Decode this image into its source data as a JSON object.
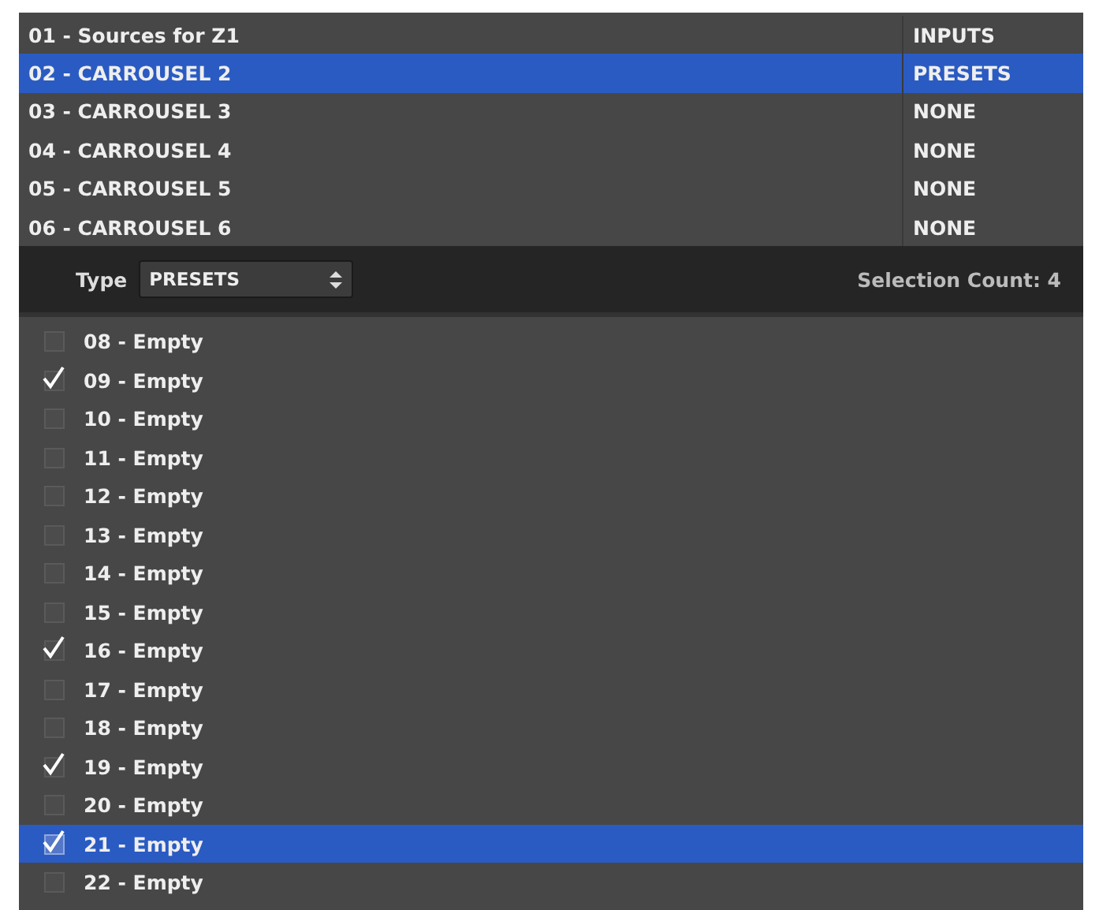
{
  "sources": [
    {
      "name": "01 - Sources for Z1",
      "type": "INPUTS",
      "selected": false
    },
    {
      "name": "02 - CARROUSEL 2",
      "type": "PRESETS",
      "selected": true
    },
    {
      "name": "03 - CARROUSEL 3",
      "type": "NONE",
      "selected": false
    },
    {
      "name": "04 - CARROUSEL 4",
      "type": "NONE",
      "selected": false
    },
    {
      "name": "05 - CARROUSEL 5",
      "type": "NONE",
      "selected": false
    },
    {
      "name": "06 - CARROUSEL 6",
      "type": "NONE",
      "selected": false
    }
  ],
  "toolbar": {
    "type_label": "Type",
    "type_value": "PRESETS",
    "selection_count": "Selection Count: 4"
  },
  "items": [
    {
      "label": "08 - Empty",
      "checked": false,
      "selected": false
    },
    {
      "label": "09 - Empty",
      "checked": true,
      "selected": false
    },
    {
      "label": "10 - Empty",
      "checked": false,
      "selected": false
    },
    {
      "label": "11 - Empty",
      "checked": false,
      "selected": false
    },
    {
      "label": "12 - Empty",
      "checked": false,
      "selected": false
    },
    {
      "label": "13 - Empty",
      "checked": false,
      "selected": false
    },
    {
      "label": "14 - Empty",
      "checked": false,
      "selected": false
    },
    {
      "label": "15 - Empty",
      "checked": false,
      "selected": false
    },
    {
      "label": "16 - Empty",
      "checked": true,
      "selected": false
    },
    {
      "label": "17 - Empty",
      "checked": false,
      "selected": false
    },
    {
      "label": "18 - Empty",
      "checked": false,
      "selected": false
    },
    {
      "label": "19 - Empty",
      "checked": true,
      "selected": false
    },
    {
      "label": "20 - Empty",
      "checked": false,
      "selected": false
    },
    {
      "label": "21 - Empty",
      "checked": true,
      "selected": true
    },
    {
      "label": "22 - Empty",
      "checked": false,
      "selected": false
    }
  ]
}
